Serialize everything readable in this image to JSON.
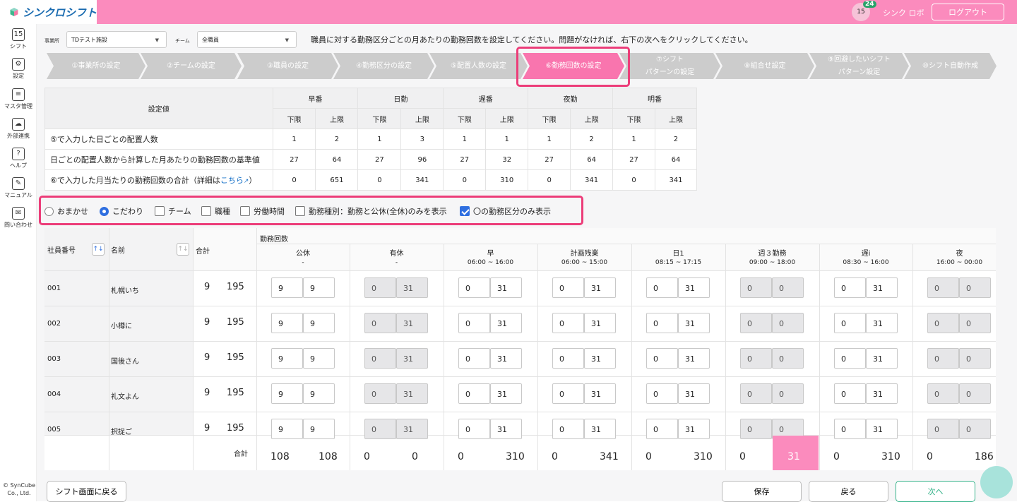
{
  "header": {
    "logo_text": "シンクロシフト",
    "calendar_day": "15",
    "notification_count": "24",
    "user_name": "シンク ロボ",
    "logout": "ログアウト"
  },
  "sidebar": {
    "items": [
      {
        "label": "シフト",
        "icon": "calendar-icon",
        "glyph": "15"
      },
      {
        "label": "設定",
        "icon": "gear-icon",
        "glyph": "⚙"
      },
      {
        "label": "マスタ管理",
        "icon": "database-icon",
        "glyph": "≡"
      },
      {
        "label": "外部連携",
        "icon": "cloud-sync-icon",
        "glyph": "☁"
      },
      {
        "label": "ヘルプ",
        "icon": "help-icon",
        "glyph": "?"
      },
      {
        "label": "マニュアル",
        "icon": "edit-icon",
        "glyph": "✎"
      },
      {
        "label": "問い合わせ",
        "icon": "mail-icon",
        "glyph": "✉"
      }
    ],
    "copyright": "© SynCube Co., Ltd."
  },
  "filters": {
    "office_label": "事業所",
    "office_value": "TDテスト施設",
    "team_label": "チーム",
    "team_value": "全職員"
  },
  "instruction": "職員に対する勤務区分ごとの月あたりの勤務回数を設定してください。問題がなければ、右下の次へをクリックしてください。",
  "steps": [
    {
      "label": "①事業所の設定"
    },
    {
      "label": "②チームの設定"
    },
    {
      "label": "③職員の設定"
    },
    {
      "label": "④勤務区分の設定"
    },
    {
      "label": "⑤配置人数の設定"
    },
    {
      "label": "⑥勤務回数の設定",
      "active": true
    },
    {
      "label": "⑦シフト\nパターンの設定"
    },
    {
      "label": "⑧組合せ設定"
    },
    {
      "label": "⑨回避したいシフト\nパターン設定"
    },
    {
      "label": "⑩シフト自動作成"
    }
  ],
  "settings_table": {
    "corner": "設定値",
    "shifts": [
      "早番",
      "日勤",
      "遅番",
      "夜勤",
      "明番"
    ],
    "lower": "下限",
    "upper": "上限",
    "rows": [
      {
        "label": "⑤で入力した日ごとの配置人数",
        "values": [
          "1",
          "2",
          "1",
          "3",
          "1",
          "1",
          "1",
          "2",
          "1",
          "2"
        ]
      },
      {
        "label": "日ごとの配置人数から計算した月あたりの勤務回数の基準値",
        "values": [
          "27",
          "64",
          "27",
          "96",
          "27",
          "32",
          "27",
          "64",
          "27",
          "64"
        ]
      },
      {
        "label": "⑥で入力した月当たりの勤務回数の合計（詳細は",
        "link": "こちら",
        "values": [
          "0",
          "651",
          "0",
          "341",
          "0",
          "310",
          "0",
          "341",
          "0",
          "341"
        ]
      }
    ]
  },
  "options": {
    "omakase": "おまかせ",
    "kodawari": "こだわり",
    "team": "チーム",
    "job": "職種",
    "hours": "労働時間",
    "worktype": "勤務種別：勤務と公休(全休)のみを表示",
    "circle_only": "〇の勤務区分のみ表示"
  },
  "grid": {
    "col_emp_no": "社員番号",
    "col_name": "名前",
    "col_total": "合計",
    "group_label": "勤務回数",
    "shifts": [
      {
        "name": "公休",
        "time": "-"
      },
      {
        "name": "有休",
        "time": "-"
      },
      {
        "name": "早",
        "time": "06:00 ~ 16:00"
      },
      {
        "name": "計画残業",
        "time": "06:00 ~ 15:00"
      },
      {
        "name": "日1",
        "time": "08:15 ~ 17:15"
      },
      {
        "name": "週３勤務",
        "time": "09:00 ~ 18:00"
      },
      {
        "name": "遅i",
        "time": "08:30 ~ 16:00"
      },
      {
        "name": "夜",
        "time": "16:00 ~ 00:00"
      }
    ],
    "rows": [
      {
        "no": "001",
        "name": "札幌いち",
        "t1": "9",
        "t2": "195"
      },
      {
        "no": "002",
        "name": "小樽に",
        "t1": "9",
        "t2": "195"
      },
      {
        "no": "003",
        "name": "国後さん",
        "t1": "9",
        "t2": "195"
      },
      {
        "no": "004",
        "name": "礼文よん",
        "t1": "9",
        "t2": "195"
      },
      {
        "no": "005",
        "name": "択捉ご",
        "t1": "9",
        "t2": "195"
      }
    ],
    "row_values": [
      [
        "9",
        "9"
      ],
      [
        "0",
        "31"
      ],
      [
        "0",
        "31"
      ],
      [
        "0",
        "31"
      ],
      [
        "0",
        "31"
      ],
      [
        "0",
        "0"
      ],
      [
        "0",
        "31"
      ],
      [
        "0",
        "0"
      ]
    ],
    "total_label": "合計",
    "totals": [
      [
        "108",
        "108"
      ],
      [
        "0",
        "0"
      ],
      [
        "0",
        "310"
      ],
      [
        "0",
        "341"
      ],
      [
        "0",
        "310"
      ],
      [
        "0",
        "31"
      ],
      [
        "0",
        "310"
      ],
      [
        "0",
        "186"
      ]
    ]
  },
  "buttons": {
    "back_to_shift": "シフト画面に戻る",
    "save": "保存",
    "back": "戻る",
    "next": "次へ"
  }
}
